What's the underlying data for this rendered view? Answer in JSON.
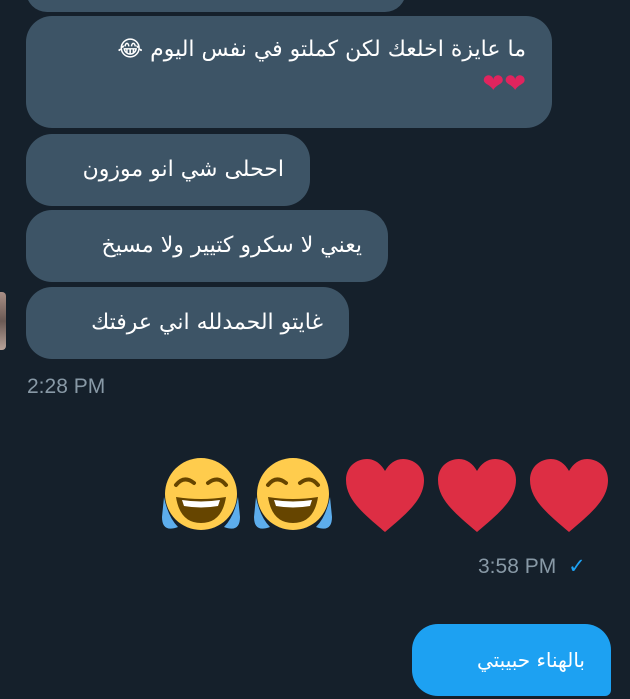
{
  "messages": {
    "m0": {
      "text": "ما عايزة اخلعك لكن كملتو في نفس اليوم 😂",
      "hearts": "❤❤"
    },
    "m1": {
      "text": "اححلى شي انو موزون"
    },
    "m2": {
      "text": "يعني لا سكرو كتيير ولا مسيخ"
    },
    "m3": {
      "text": "غايتو الحمدلله اني عرفتك"
    },
    "incoming_time": "2:28 PM",
    "emoji_message": [
      "face-with-tears-of-joy",
      "face-with-tears-of-joy",
      "red-heart",
      "red-heart",
      "red-heart"
    ],
    "outgoing_time": "3:58 PM",
    "outgoing_status": "✓",
    "reply": {
      "text": "بالهناء حبيبتي"
    }
  },
  "colors": {
    "background": "#15202b",
    "incoming_bubble": "#3d5466",
    "outgoing_bubble": "#1da1f2",
    "timestamp": "#8899a6",
    "check": "#1da1f2"
  }
}
